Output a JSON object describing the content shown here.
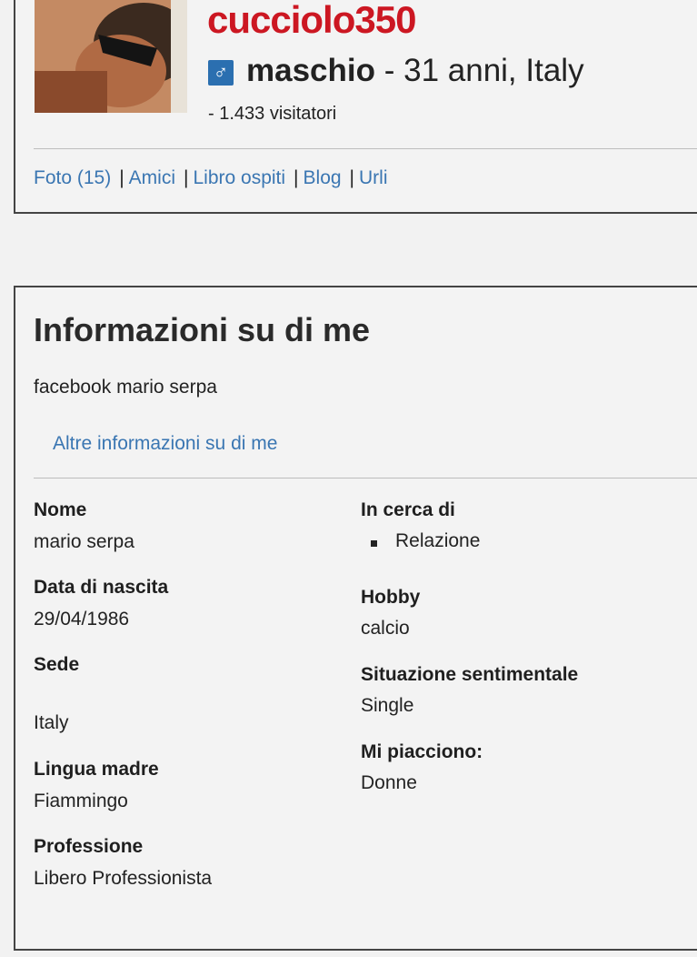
{
  "profile": {
    "username": "cucciolo350",
    "gender": "maschio",
    "gender_icon": "male-symbol-icon",
    "age_location": " - 31 anni, Italy",
    "visitors": "- 1.433 visitatori",
    "colors": {
      "username": "#cc1722",
      "link": "#3a76b2",
      "gender_icon_bg": "#2b6fb0"
    }
  },
  "nav": {
    "items": [
      "Foto (15)",
      "Amici",
      "Libro ospiti",
      "Blog",
      "Urli"
    ],
    "separator": "|"
  },
  "about": {
    "title": "Informazioni su di me",
    "text": "facebook mario serpa",
    "more_link": "Altre informazioni su di me",
    "left": {
      "name_label": "Nome",
      "name_value": "mario serpa",
      "birth_label": "Data di nascita",
      "birth_value": "29/04/1986",
      "seat_label": "Sede",
      "seat_value": "Italy",
      "language_label": "Lingua madre",
      "language_value": "Fiammingo",
      "profession_label": "Professione",
      "profession_value": "Libero Professionista"
    },
    "right": {
      "looking_label": "In cerca di",
      "looking_items": [
        "Relazione"
      ],
      "hobby_label": "Hobby",
      "hobby_value": "calcio",
      "relationship_label": "Situazione sentimentale",
      "relationship_value": "Single",
      "likes_label": "Mi piacciono:",
      "likes_value": "Donne"
    }
  }
}
